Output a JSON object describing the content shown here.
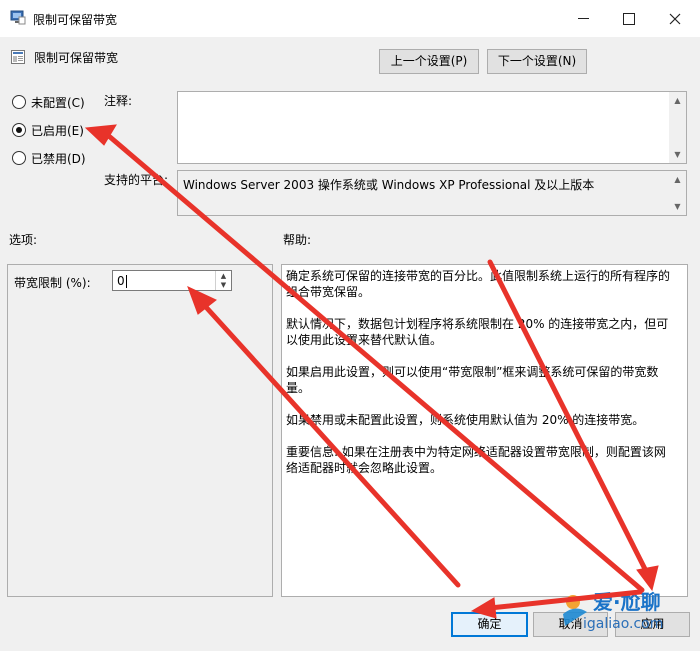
{
  "window": {
    "title": "限制可保留带宽"
  },
  "header": {
    "policy_name": "限制可保留带宽",
    "prev_button": "上一个设置(P)",
    "next_button": "下一个设置(N)"
  },
  "state": {
    "options": [
      {
        "label": "未配置(C)",
        "selected": false
      },
      {
        "label": "已启用(E)",
        "selected": true
      },
      {
        "label": "已禁用(D)",
        "selected": false
      }
    ]
  },
  "comment": {
    "label": "注释:",
    "value": ""
  },
  "platform": {
    "label": "支持的平台:",
    "value": "Windows Server 2003 操作系统或 Windows XP Professional 及以上版本"
  },
  "options_section": {
    "label": "选项:",
    "bandwidth_label": "带宽限制 (%):",
    "bandwidth_value": "0"
  },
  "help_section": {
    "label": "帮助:",
    "paragraphs": [
      "确定系统可保留的连接带宽的百分比。此值限制系统上运行的所有程序的组合带宽保留。",
      "默认情况下，数据包计划程序将系统限制在 20% 的连接带宽之内，但可以使用此设置来替代默认值。",
      "如果启用此设置，则可以使用“带宽限制”框来调整系统可保留的带宽数量。",
      "如果禁用或未配置此设置，则系统使用默认值为 20% 的连接带宽。",
      "重要信息: 如果在注册表中为特定网络适配器设置带宽限制，则配置该网络适配器时就会忽略此设置。"
    ]
  },
  "footer": {
    "ok": "确定",
    "cancel": "取消",
    "apply": "应用"
  },
  "watermark": {
    "title": "爱·尬聊",
    "subtitle": "igaliao.com"
  },
  "colors": {
    "annotation_arrow": "#e8332a",
    "focus_blue": "#0078d7"
  }
}
